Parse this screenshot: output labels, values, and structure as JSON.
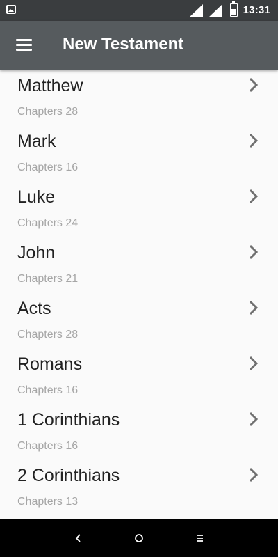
{
  "status": {
    "time": "13:31"
  },
  "appbar": {
    "title": "New Testament",
    "menu_icon": "hamburger-menu-icon"
  },
  "books": [
    {
      "name": "Matthew",
      "chapters": "Chapters 28"
    },
    {
      "name": "Mark",
      "chapters": "Chapters 16"
    },
    {
      "name": "Luke",
      "chapters": "Chapters 24"
    },
    {
      "name": "John",
      "chapters": "Chapters 21"
    },
    {
      "name": "Acts",
      "chapters": "Chapters 28"
    },
    {
      "name": "Romans",
      "chapters": "Chapters 16"
    },
    {
      "name": "1 Corinthians",
      "chapters": "Chapters 16"
    },
    {
      "name": "2 Corinthians",
      "chapters": "Chapters 13"
    }
  ],
  "colors": {
    "status_bar": "#3a3d3f",
    "app_bar": "#565b5e",
    "background": "#fafafa",
    "title_text": "#222222",
    "subtitle_text": "#a6a6a6",
    "chevron": "#707070"
  }
}
